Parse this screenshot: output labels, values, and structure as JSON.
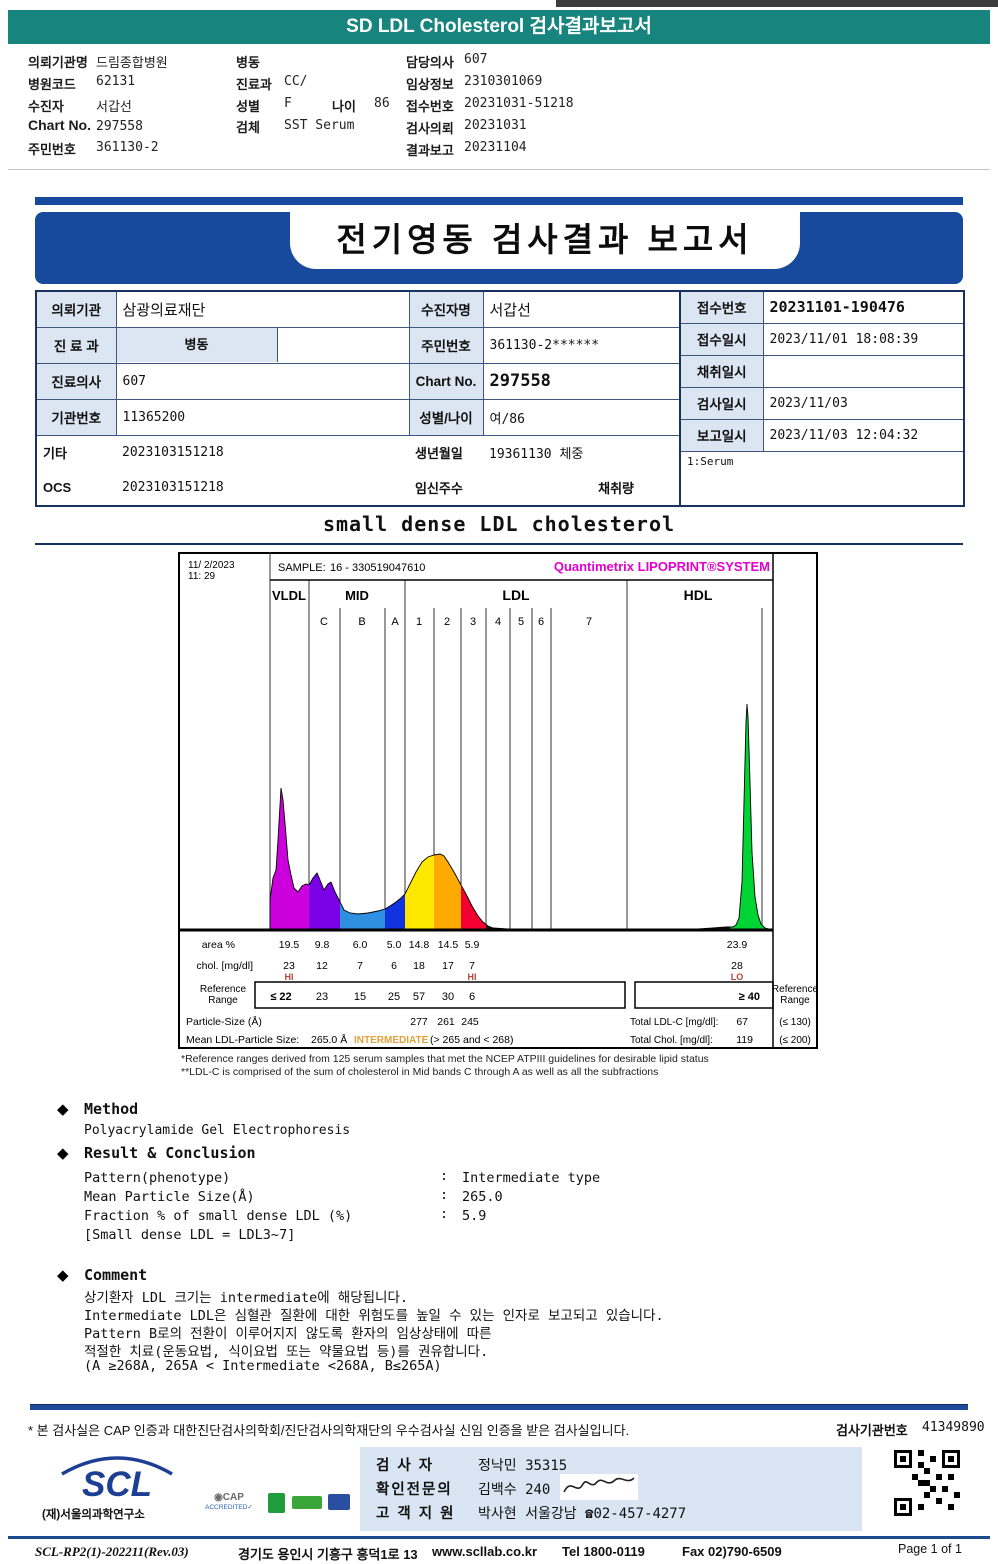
{
  "header": {
    "title": "SD LDL Cholesterol 검사결과보고서"
  },
  "patient": {
    "rows_col1": [
      {
        "label": "의뢰기관명",
        "value": "드림종합병원"
      },
      {
        "label": "병원코드",
        "value": "62131"
      },
      {
        "label": "수진자",
        "value": "서갑선"
      },
      {
        "label": "Chart No.",
        "value": "297558"
      },
      {
        "label": "주민번호",
        "value": "361130-2"
      }
    ],
    "rows_col2": [
      {
        "label": "병동",
        "value": ""
      },
      {
        "label": "진료과",
        "value": "CC/"
      },
      {
        "label": "성별",
        "value": "F",
        "label2": "나이",
        "value2": "86"
      },
      {
        "label": "검체",
        "value": "SST Serum"
      }
    ],
    "rows_col3": [
      {
        "label": "담당의사",
        "value": "607"
      },
      {
        "label": "임상정보",
        "value": "2310301069"
      },
      {
        "label": "접수번호",
        "value": "20231031-51218"
      },
      {
        "label": "검사의뢰",
        "value": "20231031"
      },
      {
        "label": "결과보고",
        "value": "20231104"
      }
    ]
  },
  "banner": {
    "title": "전기영동 검사결과 보고서"
  },
  "info_table": {
    "rows": [
      {
        "l1": "의뢰기관",
        "v1": "삼광의료재단",
        "l2": "수진자명",
        "v2": "서갑선"
      },
      {
        "l1": "진 료 과",
        "v1": "병동",
        "l2": "주민번호",
        "v2": "361130-2******"
      },
      {
        "l1": "진료의사",
        "v1": "607",
        "l2": "Chart No.",
        "v2": "297558"
      },
      {
        "l1": "기관번호",
        "v1": "11365200",
        "l2": "성별/나이",
        "v2": "여/86"
      },
      {
        "l1": "기타",
        "v1": "2023103151218",
        "l2": "생년월일",
        "v2": "19361130 체중"
      },
      {
        "l1": "OCS",
        "v1": "2023103151218",
        "l2": "임신주수",
        "v2": "채취량"
      }
    ],
    "right_rows": [
      {
        "label": "접수번호",
        "value": "20231101-190476"
      },
      {
        "label": "접수일시",
        "value": "2023/11/01 18:08:39"
      },
      {
        "label": "채취일시",
        "value": ""
      },
      {
        "label": "검사일시",
        "value": "2023/11/03"
      },
      {
        "label": "보고일시",
        "value": "2023/11/03 12:04:32"
      }
    ],
    "note": "1:Serum"
  },
  "section": {
    "title": "small dense LDL cholesterol"
  },
  "chart_data": {
    "type": "area",
    "datetime_line1": "11/ 2/2023",
    "datetime_line2": "11: 29",
    "sample_label": "SAMPLE:",
    "sample_value": "16 - 330519047610",
    "brand": "Quantimetrix LIPOPRINT®SYSTEM",
    "bands": [
      "VLDL",
      "MID",
      "LDL",
      "HDL"
    ],
    "sub_bands": [
      "C",
      "B",
      "A",
      "1",
      "2",
      "3",
      "4",
      "5",
      "6",
      "7"
    ],
    "band_area_pct": {
      "VLDL": 19.5,
      "MID_C": 9.8,
      "MID_B": 6.0,
      "MID_A": 5.0,
      "LDL1": 14.8,
      "LDL2": 14.5,
      "LDL3": 5.9,
      "HDL": 23.9
    },
    "rows": {
      "area_label": "area %",
      "area_values": [
        "19.5",
        "9.8",
        "6.0",
        "5.0",
        "14.8",
        "14.5",
        "5.9"
      ],
      "area_hdl": "23.9",
      "chol_label": "chol. [mg/dl]",
      "chol_values": [
        "23",
        "12",
        "7",
        "6",
        "18",
        "17",
        "7"
      ],
      "chol_hdl": "28",
      "flag_hi_1": "HI",
      "flag_hi_2": "HI",
      "flag_lo": "LO",
      "ref_label_line1": "Reference",
      "ref_label_line2": "Range",
      "ref_values": [
        "≤ 22",
        "23",
        "15",
        "25",
        "57",
        "30",
        "6"
      ],
      "ref_hdl": "≥ 40",
      "particle_label": "Particle-Size (Å)",
      "particle_values": [
        "277",
        "261",
        "245"
      ],
      "mean_label": "Mean LDL-Particle Size:",
      "mean_value": "265.0 Å",
      "mean_flag": "INTERMEDIATE",
      "mean_range": "(> 265 and < 268)",
      "total_ldl_label": "Total LDL-C [mg/dl]:",
      "total_ldl_value": "67",
      "total_ldl_ref": "(≤ 130)",
      "total_chol_label": "Total Chol. [mg/dl]:",
      "total_chol_value": "119",
      "total_chol_ref": "(≤ 200)"
    }
  },
  "footnotes": {
    "line1": "*Reference ranges derived from 125 serum samples that met the NCEP ATPIII guidelines for desirable lipid status",
    "line2": "**LDL-C is comprised of the sum of cholesterol in Mid bands C through A as well as all the subfractions"
  },
  "icons": {
    "diamond": "◆"
  },
  "method": {
    "heading": "Method",
    "body": "Polyacrylamide Gel Electrophoresis"
  },
  "result": {
    "heading": "Result & Conclusion",
    "separator": ":",
    "rows": [
      {
        "label": "Pattern(phenotype)",
        "value": "Intermediate type"
      },
      {
        "label": "Mean Particle Size(Å)",
        "value": "265.0"
      },
      {
        "label": "Fraction % of small dense LDL (%)",
        "value": "5.9"
      }
    ],
    "note": "[Small dense LDL = LDL3~7]"
  },
  "comment": {
    "heading": "Comment",
    "lines": [
      "상기환자 LDL 크기는 intermediate에 해당됩니다.",
      "Intermediate LDL은 심혈관 질환에 대한 위험도를 높일 수 있는 인자로 보고되고 있습니다.",
      "Pattern B로의 전환이 이루어지지 않도록 환자의 임상상태에 따른",
      "적절한 치료(운동요법, 식이요법 또는 약물요법 등)를 권유합니다.",
      "(A ≥268A, 265A < Intermediate <268A, B≤265A)"
    ]
  },
  "footer": {
    "cert_line": "* 본 검사실은 CAP 인증과 대한진단검사의학회/진단검사의학재단의 우수검사실 신임 인증을 받은 검사실입니다.",
    "org_label": "검사기관번호",
    "org_no": "41349890",
    "scl_logo": "SCL",
    "scl_sub": "(재)서울의과학연구소",
    "cap_line1": "◉CAP",
    "cap_line2": "ACCREDITED✓",
    "staff": [
      {
        "label": "검   사   자",
        "value": "정낙민 35315"
      },
      {
        "label": "확인전문의",
        "value": "김백수 240"
      },
      {
        "label": "고 객 지 원",
        "value": "박사현 서울강남 ☎02-457-4277"
      }
    ],
    "doc_no": "SCL-RP2(1)-202211(Rev.03)",
    "address": "경기도 용인시 기흥구 흥덕1로 13",
    "website": "www.scllab.co.kr",
    "tel": "Tel 1800-0119",
    "fax": "Fax 02)790-6509",
    "page": "Page 1 of 1"
  }
}
